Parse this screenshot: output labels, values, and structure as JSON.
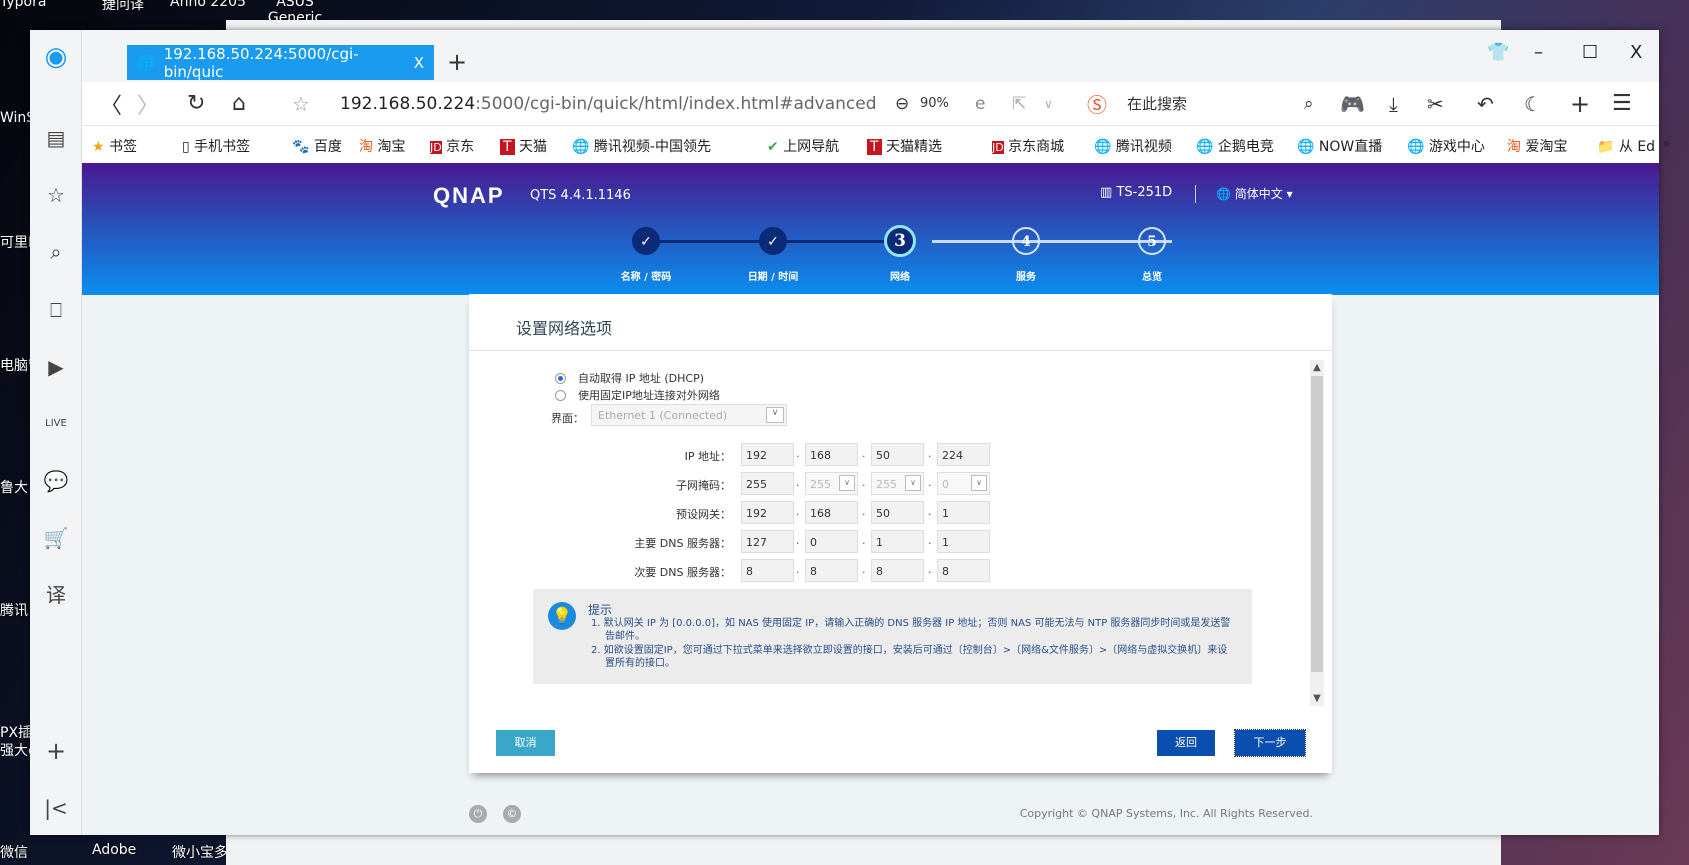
{
  "desktop": {
    "top_labels": [
      "Typora",
      "捷问译",
      "Anno 2205",
      "ASUS Generic"
    ],
    "left_labels": [
      "WinS",
      "可里E",
      "电脑管",
      "鲁大",
      "腾讯",
      "PX插",
      "强大e",
      "微信"
    ],
    "bottom_labels": [
      "Adobe",
      "微小宝多"
    ]
  },
  "browser": {
    "tab": {
      "title": "192.168.50.224:5000/cgi-bin/quic",
      "close": "X"
    },
    "new_tab": "+",
    "window_controls": {
      "skin": "👕",
      "minimize": "–",
      "maximize": "☐",
      "close": "X"
    },
    "address": {
      "host": "192.168.50.224",
      "path": ":5000/cgi-bin/quick/html/index.html#advanced",
      "zoom": "90%"
    },
    "search": {
      "placeholder": "在此搜索"
    },
    "bookmarks": [
      "书签",
      "手机书签",
      "百度",
      "淘宝",
      "京东",
      "天猫",
      "腾讯视频-中国领先",
      "上网导航",
      "天猫精选",
      "京东商城",
      "腾讯视频",
      "企鹅电竞",
      "NOW直播",
      "游戏中心",
      "爱淘宝",
      "从 Ed"
    ],
    "bookmarks_more": "»"
  },
  "qnap": {
    "logo": "QNAP",
    "version": "QTS 4.4.1.1146",
    "model": "TS-251D",
    "language": "简体中文",
    "steps": [
      {
        "num": "✓",
        "label": "名称 / 密码",
        "state": "done"
      },
      {
        "num": "✓",
        "label": "日期 / 时间",
        "state": "done"
      },
      {
        "num": "3",
        "label": "网络",
        "state": "current"
      },
      {
        "num": "4",
        "label": "服务",
        "state": "todo"
      },
      {
        "num": "5",
        "label": "总览",
        "state": "todo"
      }
    ],
    "panel_title": "设置网络选项",
    "options": [
      {
        "label": "自动取得 IP 地址 (DHCP)",
        "selected": true
      },
      {
        "label": "使用固定IP地址连接对外网络",
        "selected": false
      }
    ],
    "interface": {
      "label": "界面：",
      "value": "Ethernet 1 (Connected)"
    },
    "fields": [
      {
        "label": "IP 地址：",
        "octets": [
          "192",
          "168",
          "50",
          "224"
        ]
      },
      {
        "label": "子网掩码：",
        "octets": [
          "255",
          "255",
          "255",
          "0"
        ]
      },
      {
        "label": "预设网关：",
        "octets": [
          "192",
          "168",
          "50",
          "1"
        ]
      },
      {
        "label": "主要 DNS 服务器：",
        "octets": [
          "127",
          "0",
          "1",
          "1"
        ]
      },
      {
        "label": "次要 DNS 服务器：",
        "octets": [
          "8",
          "8",
          "8",
          "8"
        ]
      }
    ],
    "tip": {
      "title": "提示",
      "items": [
        "1. 默认网关 IP 为 [0.0.0.0]，如 NAS 使用固定 IP，请输入正确的 DNS 服务器 IP 地址；否则 NAS 可能无法与 NTP 服务器同步时间或是发送警告邮件。",
        "2. 如欲设置固定IP，您可通过下拉式菜单来选择欲立即设置的接口，安装后可通过〔控制台〕>〔网络&文件服务〕>〔网络与虚拟交换机〕来设置所有的接口。"
      ]
    },
    "buttons": {
      "cancel": "取消",
      "back": "返回",
      "next": "下一步"
    },
    "copyright": "Copyright © QNAP Systems, Inc. All Rights Reserved.",
    "colors": {
      "hero_top": "#4a1890",
      "hero_bottom": "#0a8ef0",
      "cancel": "#3aa6c8",
      "primary": "#0a4fb0"
    }
  }
}
